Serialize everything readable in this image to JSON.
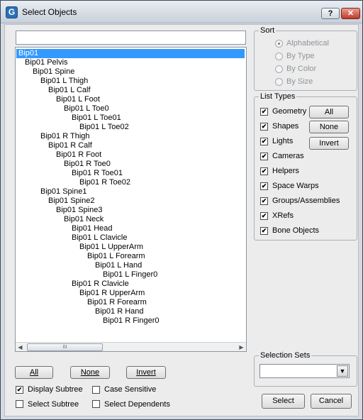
{
  "window": {
    "title": "Select Objects",
    "help_label": "?",
    "close_label": "✕",
    "app_icon": "3ds-max-icon"
  },
  "filter": {
    "value": "",
    "placeholder": ""
  },
  "tree": {
    "items": [
      {
        "label": "Bip01",
        "selected": true
      },
      {
        "label": "Bip01 Pelvis"
      },
      {
        "label": "Bip01 Spine"
      },
      {
        "label": "Bip01 L Thigh"
      },
      {
        "label": "Bip01 L Calf"
      },
      {
        "label": "Bip01 L Foot"
      },
      {
        "label": "Bip01 L Toe0"
      },
      {
        "label": "Bip01 L Toe01"
      },
      {
        "label": "Bip01 L Toe02"
      },
      {
        "label": "Bip01 R Thigh"
      },
      {
        "label": "Bip01 R Calf"
      },
      {
        "label": "Bip01 R Foot"
      },
      {
        "label": "Bip01 R Toe0"
      },
      {
        "label": "Bip01 R Toe01"
      },
      {
        "label": "Bip01 R Toe02"
      },
      {
        "label": "Bip01 Spine1"
      },
      {
        "label": "Bip01 Spine2"
      },
      {
        "label": "Bip01 Spine3"
      },
      {
        "label": "Bip01 Neck"
      },
      {
        "label": "Bip01 Head"
      },
      {
        "label": "Bip01 L Clavicle"
      },
      {
        "label": "Bip01 L UpperArm"
      },
      {
        "label": "Bip01 L Forearm"
      },
      {
        "label": "Bip01 L Hand"
      },
      {
        "label": "Bip01 L Finger0"
      },
      {
        "label": "Bip01 R Clavicle"
      },
      {
        "label": "Bip01 R UpperArm"
      },
      {
        "label": "Bip01 R Forearm"
      },
      {
        "label": "Bip01 R Hand"
      },
      {
        "label": "Bip01 R Finger0"
      }
    ],
    "scroll_thumb_text": "III"
  },
  "bottom_buttons": {
    "all": "All",
    "none": "None",
    "invert": "Invert"
  },
  "options": {
    "display_subtree": {
      "label": "Display Subtree",
      "checked": true
    },
    "case_sensitive": {
      "label": "Case Sensitive",
      "checked": false
    },
    "select_subtree": {
      "label": "Select Subtree",
      "checked": false
    },
    "select_dependents": {
      "label": "Select Dependents",
      "checked": false
    }
  },
  "sort": {
    "title": "Sort",
    "options": [
      {
        "label": "Alphabetical",
        "selected": true
      },
      {
        "label": "By Type"
      },
      {
        "label": "By Color"
      },
      {
        "label": "By Size"
      }
    ]
  },
  "list_types": {
    "title": "List Types",
    "items": [
      {
        "label": "Geometry",
        "checked": true
      },
      {
        "label": "Shapes",
        "checked": true
      },
      {
        "label": "Lights",
        "checked": true
      },
      {
        "label": "Cameras",
        "checked": true
      },
      {
        "label": "Helpers",
        "checked": true
      },
      {
        "label": "Space Warps",
        "checked": true
      },
      {
        "label": "Groups/Assemblies",
        "checked": true
      },
      {
        "label": "XRefs",
        "checked": true
      },
      {
        "label": "Bone Objects",
        "checked": true
      }
    ],
    "all_label": "All",
    "none_label": "None",
    "invert_label": "Invert"
  },
  "selection_sets": {
    "title": "Selection Sets",
    "value": ""
  },
  "actions": {
    "select": "Select",
    "cancel": "Cancel"
  }
}
